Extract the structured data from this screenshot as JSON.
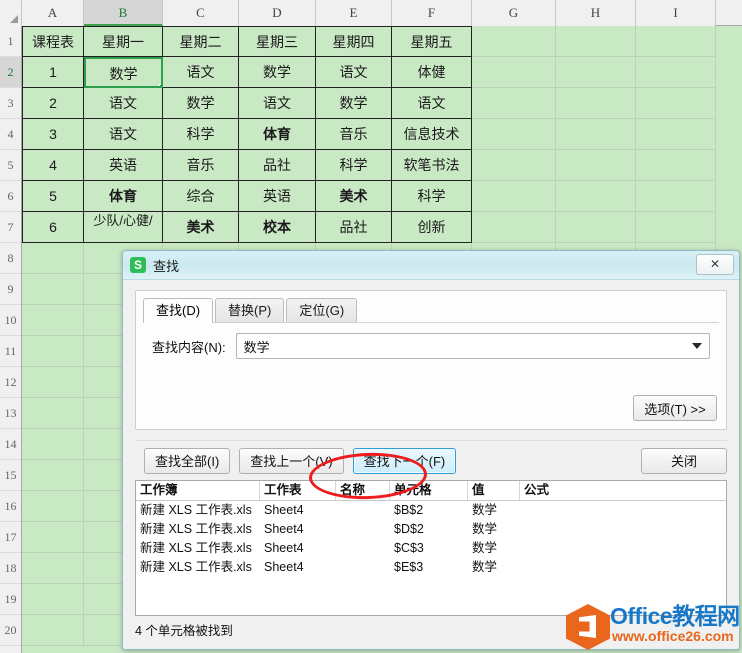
{
  "spreadsheet": {
    "column_headers": [
      "A",
      "B",
      "C",
      "D",
      "E",
      "F",
      "G",
      "H",
      "I"
    ],
    "selected_column": "B",
    "selected_row": "2",
    "active_cell": "B2",
    "row_headers": [
      "1",
      "2",
      "3",
      "4",
      "5",
      "6",
      "7",
      "8",
      "9",
      "10",
      "11",
      "12",
      "13",
      "14",
      "15",
      "16",
      "17",
      "18",
      "19",
      "20"
    ],
    "rows": [
      {
        "num": "1",
        "cells": [
          "课程表",
          "星期一",
          "星期二",
          "星期三",
          "星期四",
          "星期五"
        ]
      },
      {
        "num": "2",
        "cells": [
          "1",
          "数学",
          "语文",
          "数学",
          "语文",
          "体健"
        ]
      },
      {
        "num": "3",
        "cells": [
          "2",
          "语文",
          "数学",
          "语文",
          "数学",
          "语文"
        ]
      },
      {
        "num": "4",
        "cells": [
          "3",
          "语文",
          "科学",
          "体育",
          "音乐",
          "信息技术"
        ]
      },
      {
        "num": "5",
        "cells": [
          "4",
          "英语",
          "音乐",
          "品社",
          "科学",
          "软笔书法"
        ]
      },
      {
        "num": "6",
        "cells": [
          "5",
          "体育",
          "综合",
          "英语",
          "美术",
          "科学"
        ]
      },
      {
        "num": "7",
        "cells": [
          "6",
          "少队/心健/",
          "美术",
          "校本",
          "品社",
          "创新"
        ]
      }
    ],
    "bold_cells": [
      "D4",
      "B6",
      "E6",
      "C7",
      "D7"
    ],
    "colors": {
      "cell_fill": "#c9e8c4",
      "grid_line": "#b9d4b4",
      "table_border": "#222222",
      "active_border": "#2e9e4f",
      "header_bg": "#f0f0f0"
    }
  },
  "dialog": {
    "title": "查找",
    "app_icon": "wps-spreadsheet-icon",
    "close_label": "✕",
    "tabs": [
      {
        "label": "查找(D)",
        "active": true
      },
      {
        "label": "替换(P)",
        "active": false
      },
      {
        "label": "定位(G)",
        "active": false
      }
    ],
    "find_field": {
      "label": "查找内容(N):",
      "value": "数学",
      "placeholder": ""
    },
    "options_button": "选项(T) >>",
    "buttons": [
      {
        "label": "查找全部(I)",
        "primary": false,
        "annotated": true
      },
      {
        "label": "查找上一个(V)",
        "primary": false,
        "annotated": false
      },
      {
        "label": "查找下一个(F)",
        "primary": true,
        "annotated": false
      },
      {
        "label": "关闭",
        "primary": false,
        "annotated": false
      }
    ],
    "results": {
      "columns": [
        "工作簿",
        "工作表",
        "名称",
        "单元格",
        "值",
        "公式"
      ],
      "rows": [
        {
          "workbook": "新建 XLS 工作表.xls",
          "sheet": "Sheet4",
          "name": "",
          "cell": "$B$2",
          "value": "数学",
          "formula": ""
        },
        {
          "workbook": "新建 XLS 工作表.xls",
          "sheet": "Sheet4",
          "name": "",
          "cell": "$D$2",
          "value": "数学",
          "formula": ""
        },
        {
          "workbook": "新建 XLS 工作表.xls",
          "sheet": "Sheet4",
          "name": "",
          "cell": "$C$3",
          "value": "数学",
          "formula": ""
        },
        {
          "workbook": "新建 XLS 工作表.xls",
          "sheet": "Sheet4",
          "name": "",
          "cell": "$E$3",
          "value": "数学",
          "formula": ""
        }
      ]
    },
    "status_text": "4 个单元格被找到",
    "annotation_color": "#ee1c1c"
  },
  "watermark": {
    "title": "Office教程网",
    "url": "www.office26.com",
    "logo_color": "#e8671c",
    "title_color": "#1878c8"
  }
}
